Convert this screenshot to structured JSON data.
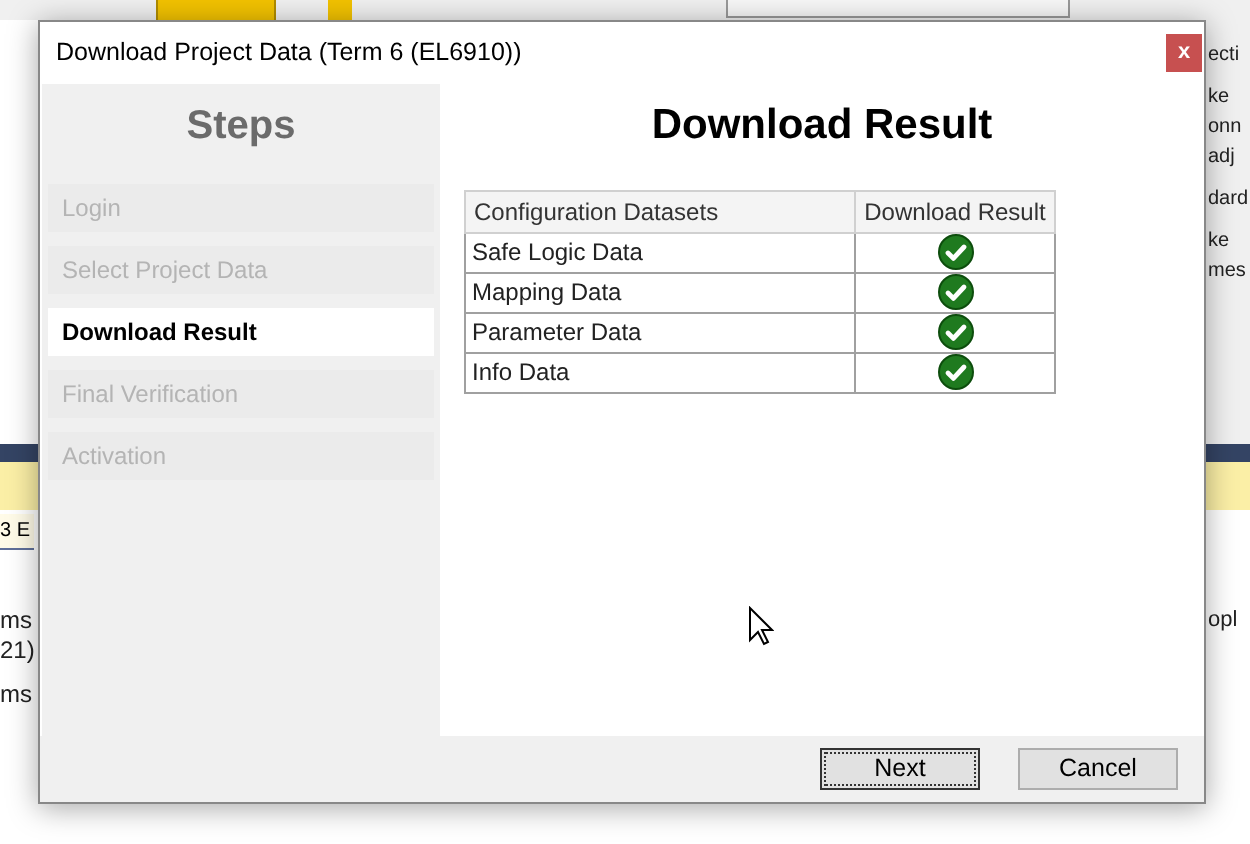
{
  "background": {
    "right_texts": [
      "ecti",
      "ke",
      "onn",
      "adj",
      "dard",
      "ke",
      "mes"
    ],
    "left_field": "3 E",
    "left_texts": [
      "ms",
      "21)",
      "ms"
    ],
    "right_lower_text": "opl"
  },
  "dialog": {
    "title": "Download Project Data (Term 6 (EL6910))",
    "close_label": "x",
    "steps_title": "Steps",
    "steps": [
      {
        "label": "Login",
        "selected": false
      },
      {
        "label": "Select Project Data",
        "selected": false
      },
      {
        "label": "Download Result",
        "selected": true
      },
      {
        "label": "Final Verification",
        "selected": false
      },
      {
        "label": "Activation",
        "selected": false
      }
    ],
    "heading": "Download Result",
    "table": {
      "columns": [
        "Configuration Datasets",
        "Download Result"
      ],
      "rows": [
        {
          "name": "Safe Logic Data",
          "downloaded": true
        },
        {
          "name": "Mapping Data",
          "downloaded": true
        },
        {
          "name": "Parameter Data",
          "downloaded": true
        },
        {
          "name": "Info Data",
          "downloaded": true
        }
      ]
    },
    "buttons": [
      {
        "label": "Next",
        "focused": true
      },
      {
        "label": "Cancel",
        "focused": false
      }
    ]
  }
}
